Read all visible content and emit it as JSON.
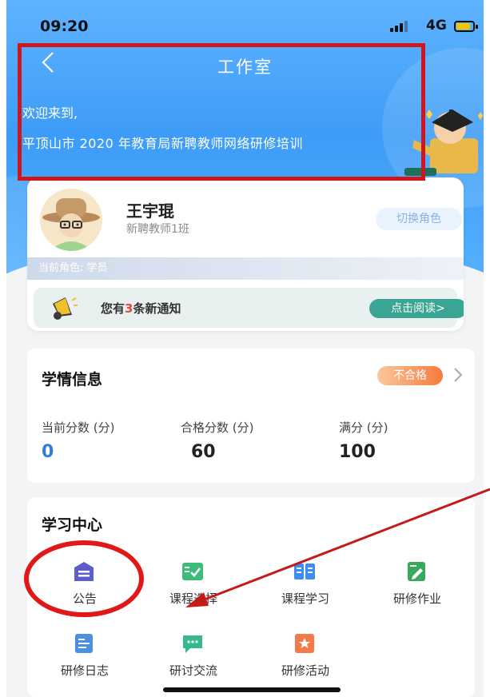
{
  "status_bar": {
    "time": "09:20",
    "network": "4G"
  },
  "header": {
    "title": "工作室",
    "welcome": "欢迎来到,",
    "program": "平顶山市 2020 年教育局新聘教师网络研修培训"
  },
  "profile": {
    "name": "王宇琨",
    "class": "新聘教师1班",
    "switch_role_label": "切换角色",
    "current_role": "当前角色: 学员"
  },
  "notice": {
    "prefix": "您有",
    "count": "3",
    "suffix": "条新通知",
    "read_button": "点击阅读>"
  },
  "study_info": {
    "title": "学情信息",
    "status_badge": "不合格",
    "stats": [
      {
        "label": "当前分数 (分)",
        "value": "0"
      },
      {
        "label": "合格分数 (分)",
        "value": "60"
      },
      {
        "label": "满分 (分)",
        "value": "100"
      }
    ]
  },
  "learning_center": {
    "title": "学习中心",
    "items": [
      {
        "label": "公告",
        "icon": "announcement-icon",
        "color": "#5b5fc7"
      },
      {
        "label": "课程选择",
        "icon": "course-select-icon",
        "color": "#3dbb7a"
      },
      {
        "label": "课程学习",
        "icon": "course-study-icon",
        "color": "#3d8ef0"
      },
      {
        "label": "研修作业",
        "icon": "homework-icon",
        "color": "#3aa85a"
      },
      {
        "label": "研修日志",
        "icon": "journal-icon",
        "color": "#4a90e2"
      },
      {
        "label": "研讨交流",
        "icon": "discussion-icon",
        "color": "#35b88c"
      },
      {
        "label": "研修活动",
        "icon": "activity-icon",
        "color": "#f27b4b"
      }
    ]
  },
  "colors": {
    "accent": "#3d9cf7",
    "annotation": "#d0161d",
    "notice_button": "#3aa593",
    "score": "#2f7fd6"
  }
}
